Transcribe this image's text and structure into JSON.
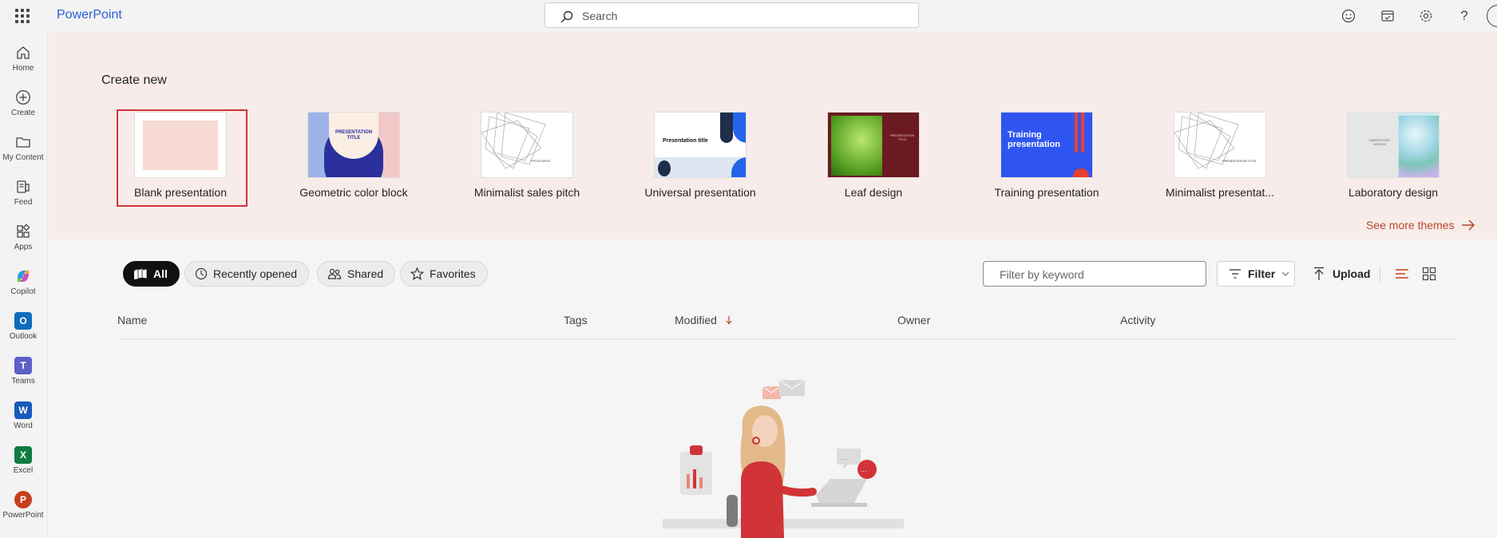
{
  "app": {
    "title": "PowerPoint"
  },
  "search": {
    "placeholder": "Search"
  },
  "top_icons": [
    "feedback-icon",
    "whats-new-icon",
    "settings-icon",
    "help-icon"
  ],
  "rail": [
    {
      "label": "Home",
      "icon": "home-icon"
    },
    {
      "label": "Create",
      "icon": "create-icon"
    },
    {
      "label": "My Content",
      "icon": "folder-icon"
    },
    {
      "label": "Feed",
      "icon": "feed-icon"
    },
    {
      "label": "Apps",
      "icon": "apps-icon"
    },
    {
      "label": "Copilot",
      "icon": "copilot-icon"
    },
    {
      "label": "Outlook",
      "icon": "outlook-icon",
      "letter": "O",
      "color": "#0f6cbd"
    },
    {
      "label": "Teams",
      "icon": "teams-icon",
      "letter": "T",
      "color": "#5b5fc7"
    },
    {
      "label": "Word",
      "icon": "word-icon",
      "letter": "W",
      "color": "#185abd"
    },
    {
      "label": "Excel",
      "icon": "excel-icon",
      "letter": "X",
      "color": "#107c41"
    },
    {
      "label": "PowerPoint",
      "icon": "powerpoint-icon",
      "letter": "P",
      "color": "#c43e1c"
    }
  ],
  "create": {
    "title": "Create new",
    "templates": [
      {
        "label": "Blank presentation",
        "selected": true
      },
      {
        "label": "Geometric color block",
        "thumb_text": "PRESENTATION TITLE"
      },
      {
        "label": "Minimalist sales pitch",
        "thumb_text": "PITCH DECK"
      },
      {
        "label": "Universal presentation",
        "thumb_text": "Presentation title"
      },
      {
        "label": "Leaf design",
        "thumb_text": "PRESENTATION TITLE"
      },
      {
        "label": "Training presentation",
        "thumb_text": "Training presentation"
      },
      {
        "label": "Minimalist presentat...",
        "thumb_text": "PRESENTATION TITLE"
      },
      {
        "label": "Laboratory design",
        "thumb_text": "LABORATORY DESIGN"
      }
    ],
    "see_more": "See more themes"
  },
  "filters": {
    "pills": [
      "All",
      "Recently opened",
      "Shared",
      "Favorites"
    ],
    "active": "All",
    "keyword_placeholder": "Filter by keyword",
    "filter_label": "Filter",
    "upload_label": "Upload"
  },
  "table": {
    "columns": [
      "Name",
      "Tags",
      "Modified",
      "Owner",
      "Activity"
    ],
    "sorted_by": "Modified",
    "sort_direction": "descending"
  },
  "colors": {
    "accent": "#b7472a",
    "brand_blue": "#2b5fd9",
    "selection": "#d13438"
  }
}
